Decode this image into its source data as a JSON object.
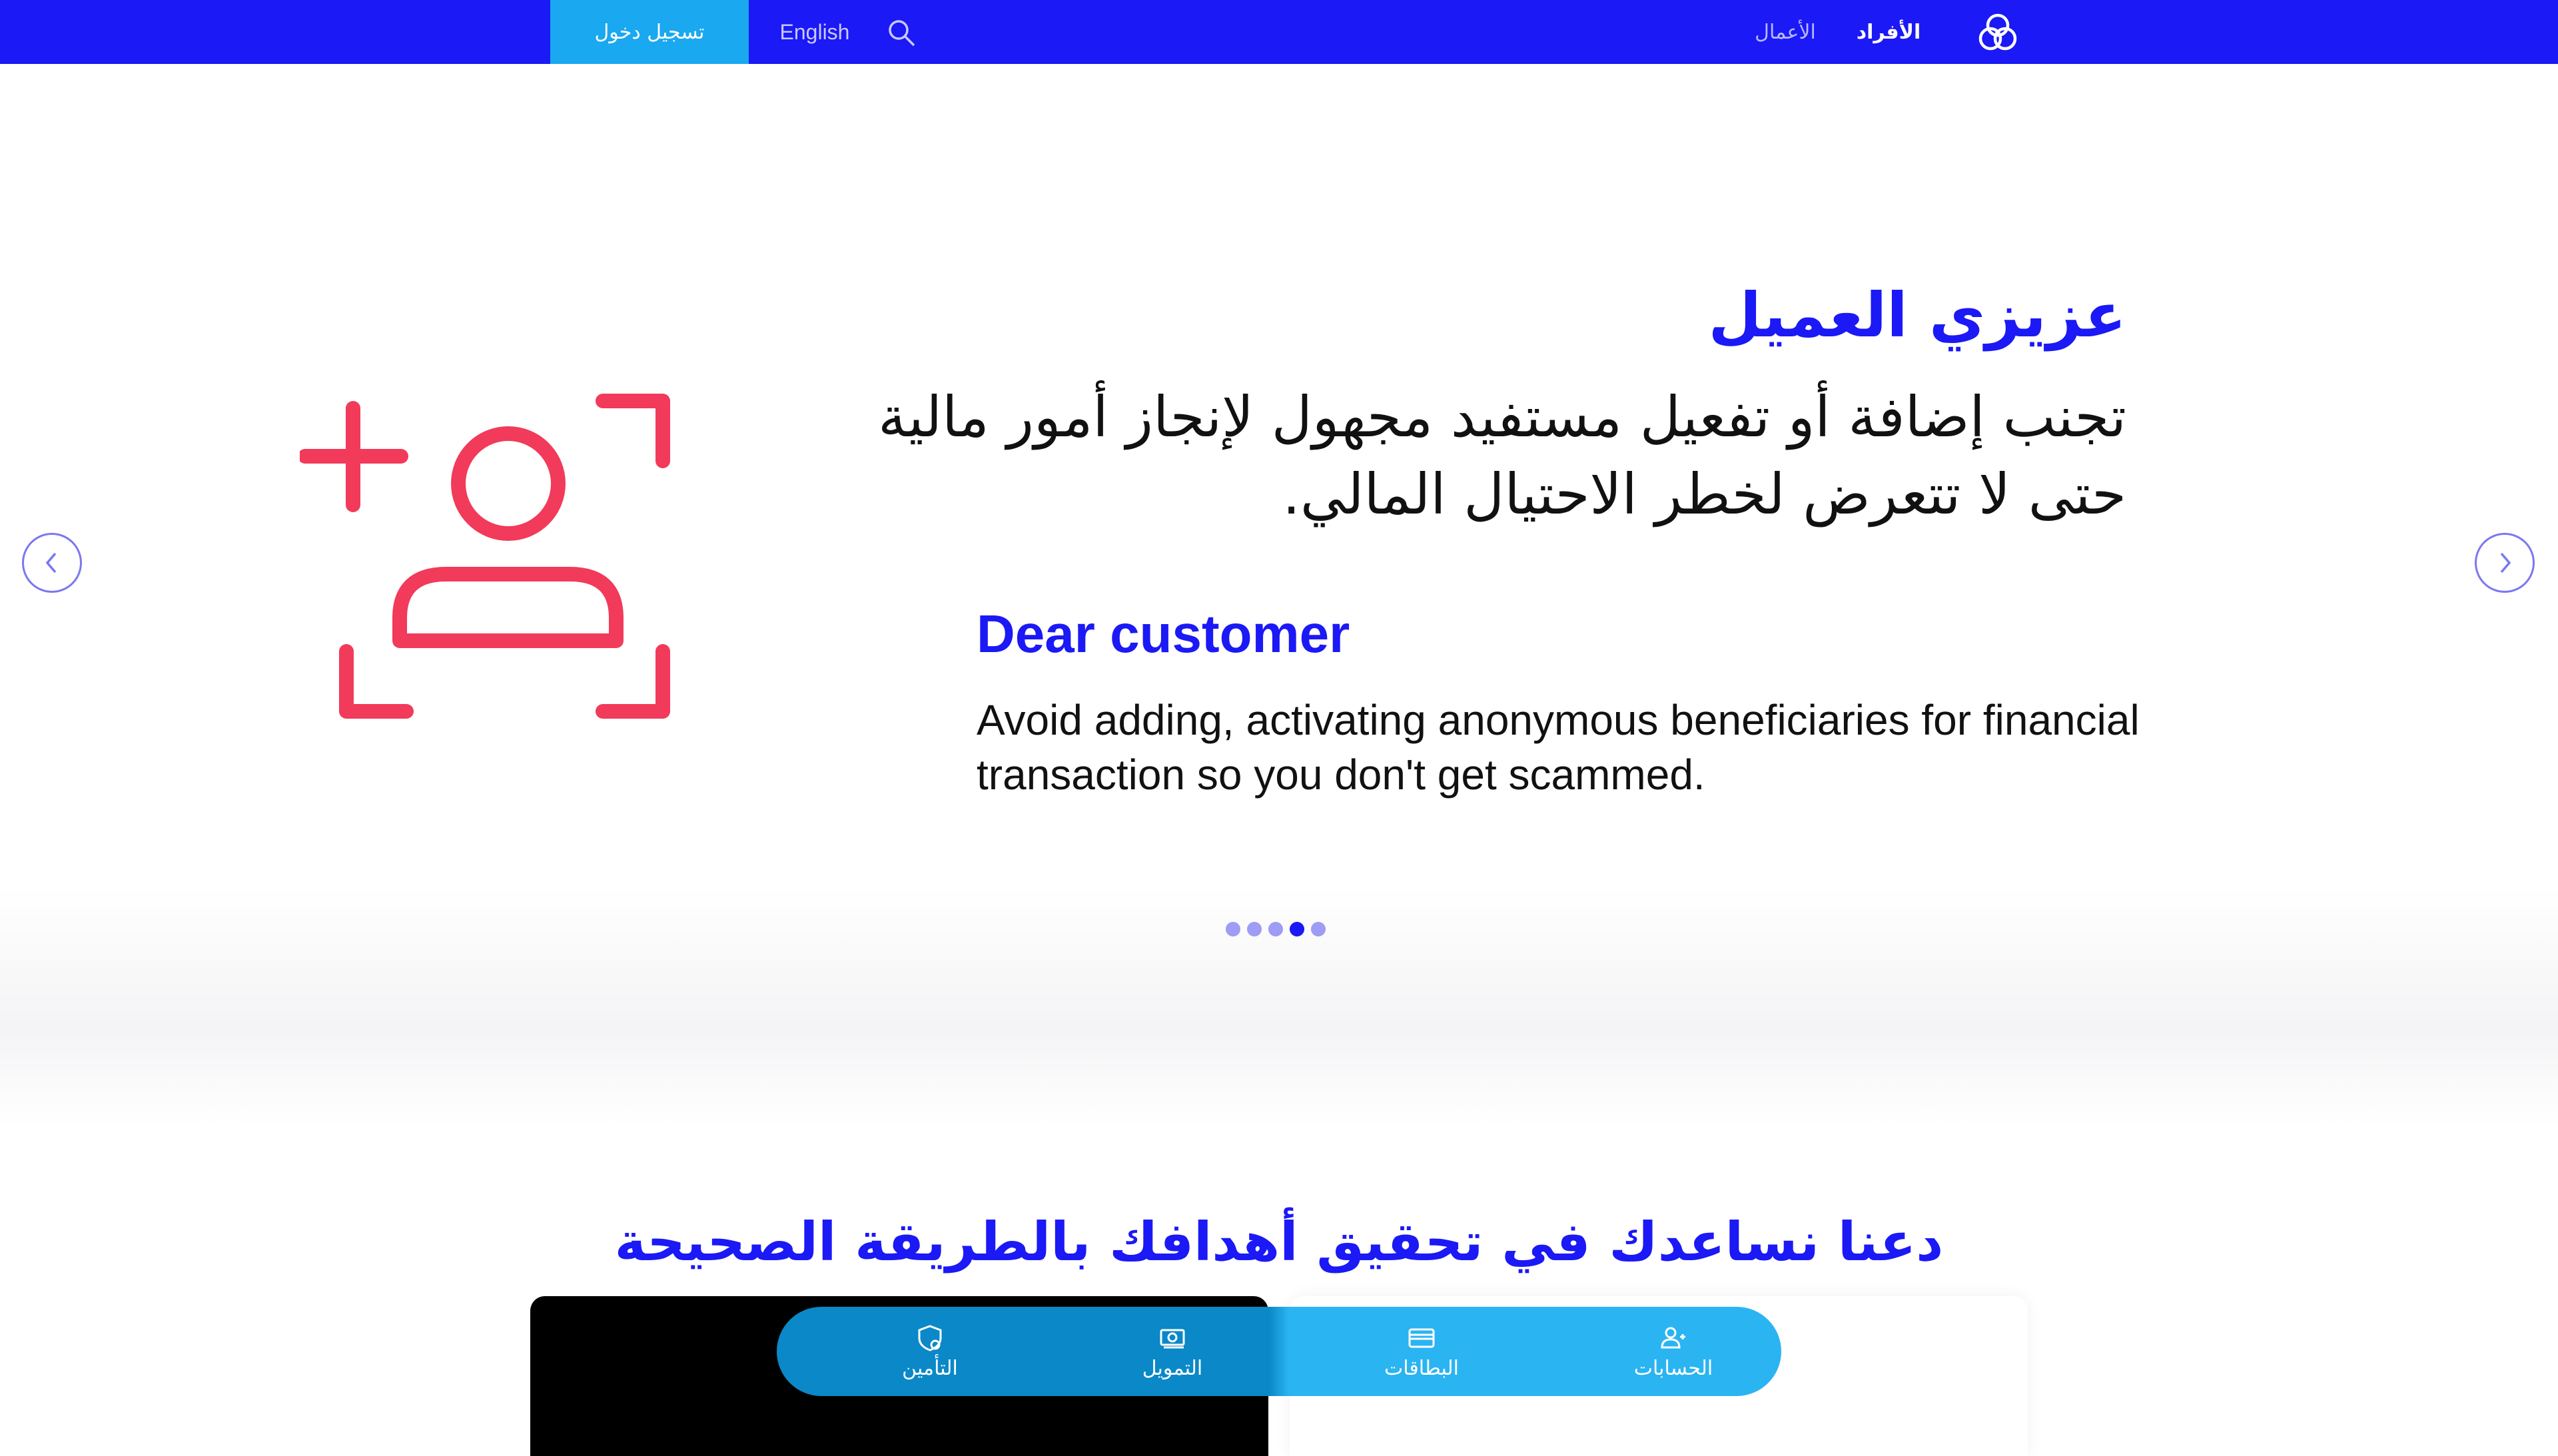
{
  "navbar": {
    "login_label": "تسجيل دخول",
    "language_label": "English",
    "tab_business": "الأعمال",
    "tab_individuals": "الأفراد",
    "background_color": "#1b19f5",
    "login_color": "#1aa8f0"
  },
  "hero": {
    "ar_heading": "عزيزي العميل",
    "ar_body": "تجنب إضافة أو تفعيل مستفيد مجهول لإنجاز أمور مالية حتى لا تتعرض لخطر الاحتيال المالي.",
    "en_heading": "Dear customer",
    "en_body": "Avoid adding, activating anonymous beneficiaries for financial transaction so you don't get scammed.",
    "icon": "add-user-icon",
    "icon_color": "#f23a5a",
    "slides_count": 5,
    "active_slide": 4
  },
  "section": {
    "title": "دعنا نساعدك في تحقيق أهدافك بالطريقة الصحيحة",
    "card_left_title": "",
    "card_right_title": ""
  },
  "tabbar": {
    "items": [
      {
        "label": "التأمين",
        "icon": "shield-icon"
      },
      {
        "label": "التمويل",
        "icon": "banknote-icon"
      },
      {
        "label": "البطاقات",
        "icon": "card-icon"
      },
      {
        "label": "الحسابات",
        "icon": "accounts-icon"
      }
    ]
  }
}
